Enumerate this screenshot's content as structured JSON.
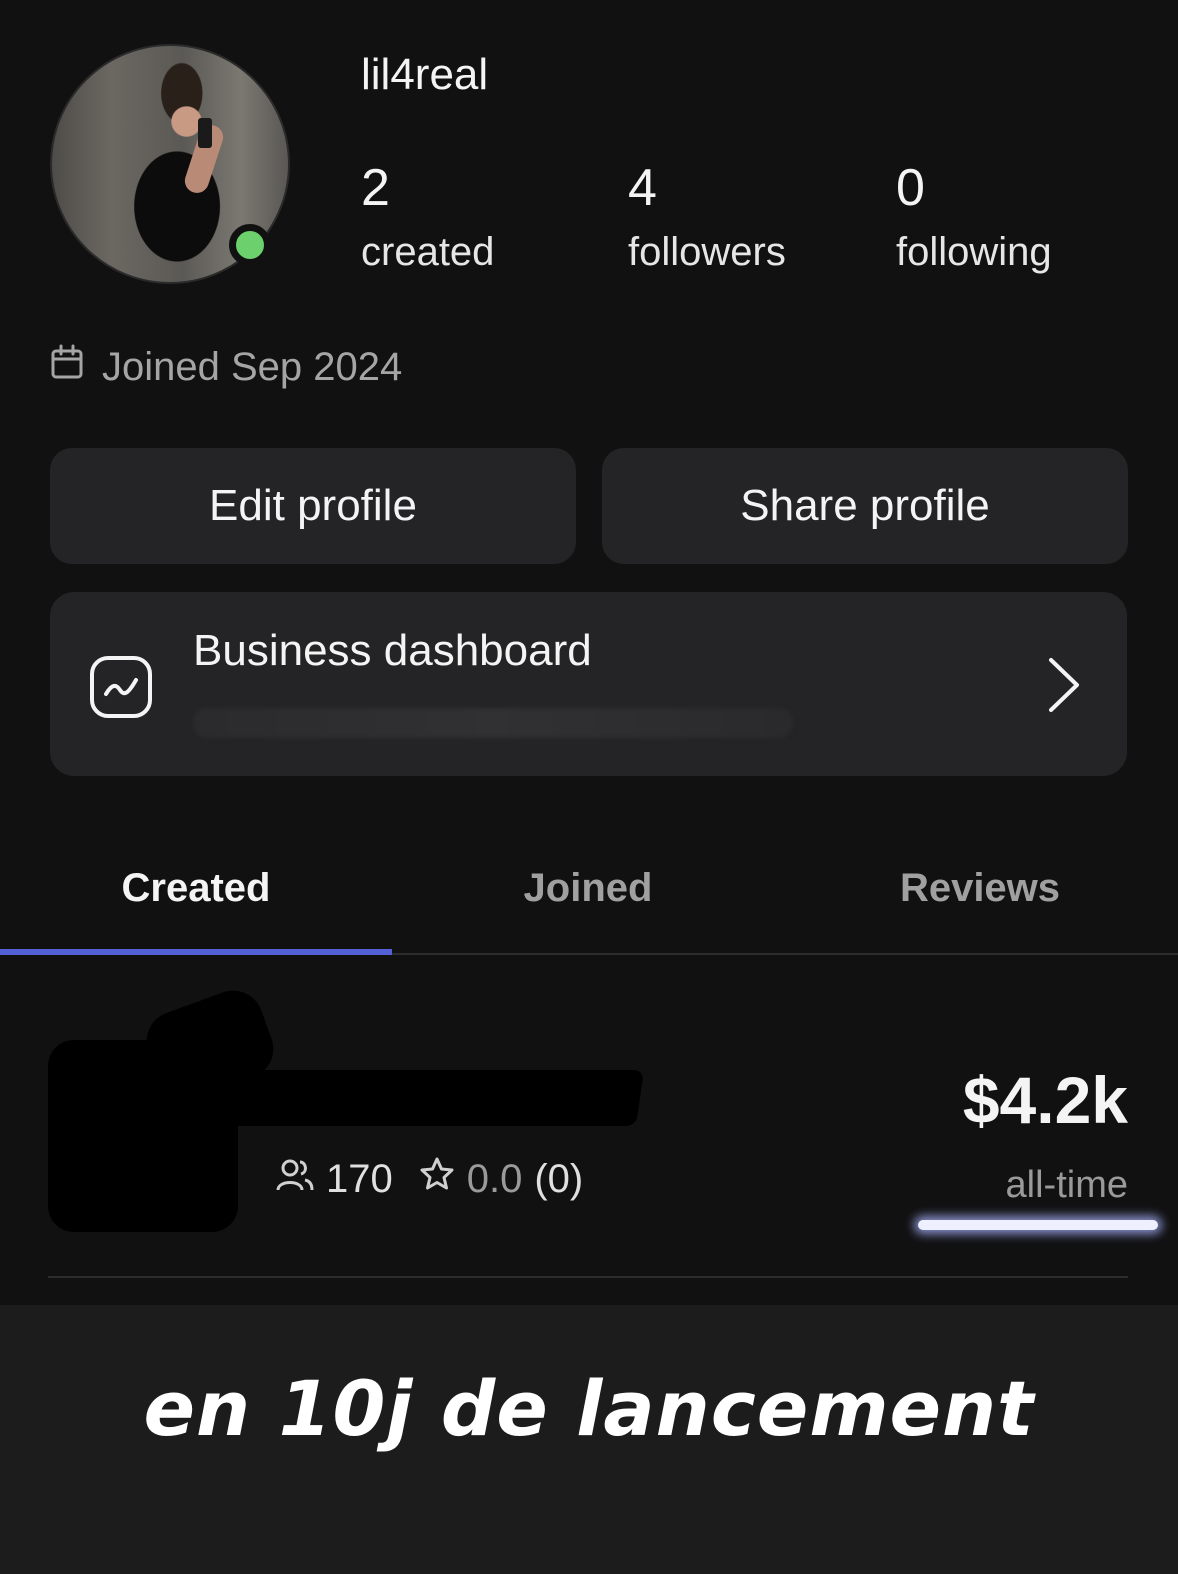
{
  "profile": {
    "username": "lil4real",
    "online": true,
    "stats": [
      {
        "value": "2",
        "label": "created"
      },
      {
        "value": "4",
        "label": "followers"
      },
      {
        "value": "0",
        "label": "following"
      }
    ],
    "joined": "Joined Sep 2024"
  },
  "actions": {
    "edit_label": "Edit profile",
    "share_label": "Share profile"
  },
  "business": {
    "title": "Business dashboard"
  },
  "tabs": [
    {
      "label": "Created",
      "active": true
    },
    {
      "label": "Joined",
      "active": false
    },
    {
      "label": "Reviews",
      "active": false
    }
  ],
  "item": {
    "members": "170",
    "rating": "0.0",
    "reviews": "(0)",
    "amount": "$4.2k",
    "amount_period": "all-time"
  },
  "caption": "en 10j de lancement",
  "colors": {
    "accent": "#5360d6",
    "online": "#6cd06c",
    "card": "#242426",
    "background": "#111112"
  }
}
